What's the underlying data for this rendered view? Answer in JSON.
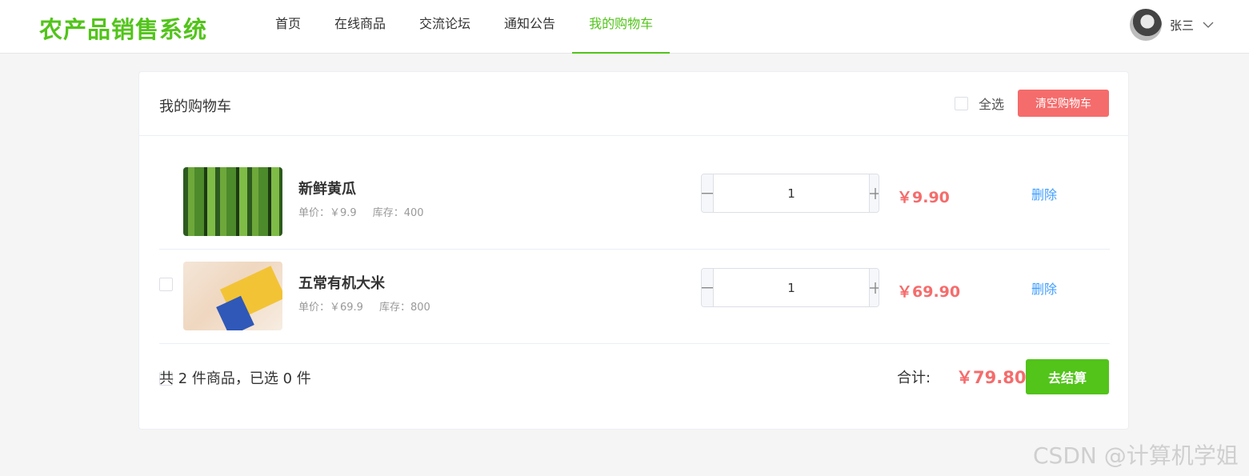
{
  "header": {
    "logo": "农产品销售系统",
    "nav": [
      {
        "label": "首页"
      },
      {
        "label": "在线商品"
      },
      {
        "label": "交流论坛"
      },
      {
        "label": "通知公告"
      },
      {
        "label": "我的购物车",
        "active": true
      }
    ],
    "user_name": "张三"
  },
  "cart": {
    "title": "我的购物车",
    "select_all_label": "全选",
    "clear_label": "清空购物车",
    "items": [
      {
        "name": "新鲜黄瓜",
        "unit_price": "单价：￥9.9",
        "stock": "库存：400",
        "quantity": "1",
        "subtotal": "￥9.90",
        "delete_label": "删除"
      },
      {
        "name": "五常有机大米",
        "unit_price": "单价：￥69.9",
        "stock": "库存：800",
        "quantity": "1",
        "subtotal": "￥69.90",
        "delete_label": "删除"
      }
    ],
    "summary": "共 2 件商品，已选 0 件",
    "total_label": "合计:",
    "total_value": "￥79.80",
    "checkout_label": "去结算"
  },
  "watermark": "CSDN @计算机学姐",
  "colors": {
    "brand": "#52c41a",
    "danger": "#f56c6c",
    "link": "#409eff"
  }
}
